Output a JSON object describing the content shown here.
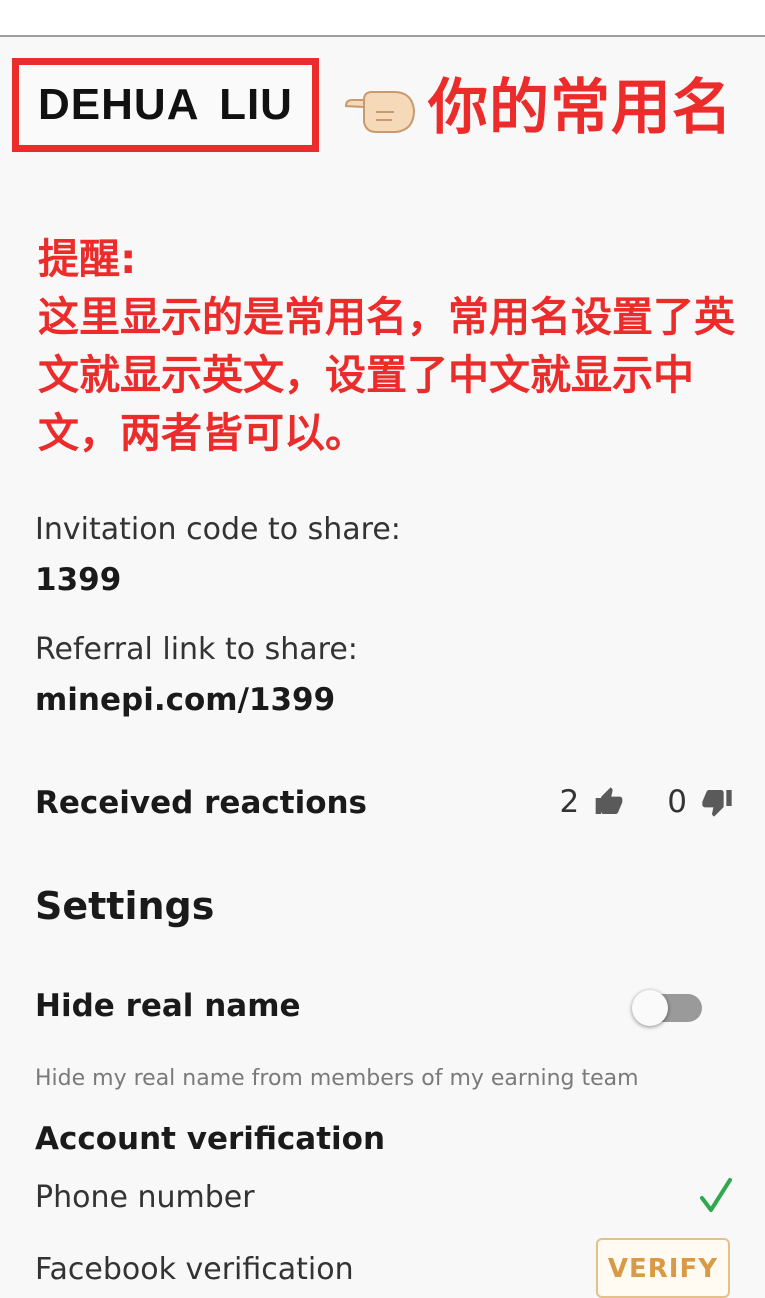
{
  "profile": {
    "name": "DEHUA  LIU",
    "callout": "你的常用名"
  },
  "reminder": {
    "title": "提醒:",
    "body": "这里显示的是常用名，常用名设置了英文就显示英文，设置了中文就显示中文，两者皆可以。"
  },
  "invitation": {
    "label": "Invitation code to share:",
    "value": "1399"
  },
  "referral": {
    "label": "Referral link to share:",
    "value": "minepi.com/1399"
  },
  "reactions": {
    "label": "Received reactions",
    "likes": "2",
    "dislikes": "0"
  },
  "settings": {
    "title": "Settings",
    "hide_real_name": {
      "label": "Hide real name",
      "hint": "Hide my real name from members of my earning team",
      "enabled": false
    }
  },
  "verification": {
    "title": "Account verification",
    "phone_label": "Phone number",
    "phone_status": "verified",
    "facebook_label": "Facebook verification",
    "verify_button": "VERIFY"
  },
  "colors": {
    "annotation_red": "#ec2b2b",
    "check_green": "#2fa84f",
    "verify_orange": "#d89a45"
  },
  "icons": [
    "pointing-hand-icon",
    "thumbs-up-icon",
    "thumbs-down-icon",
    "checkmark-icon"
  ]
}
